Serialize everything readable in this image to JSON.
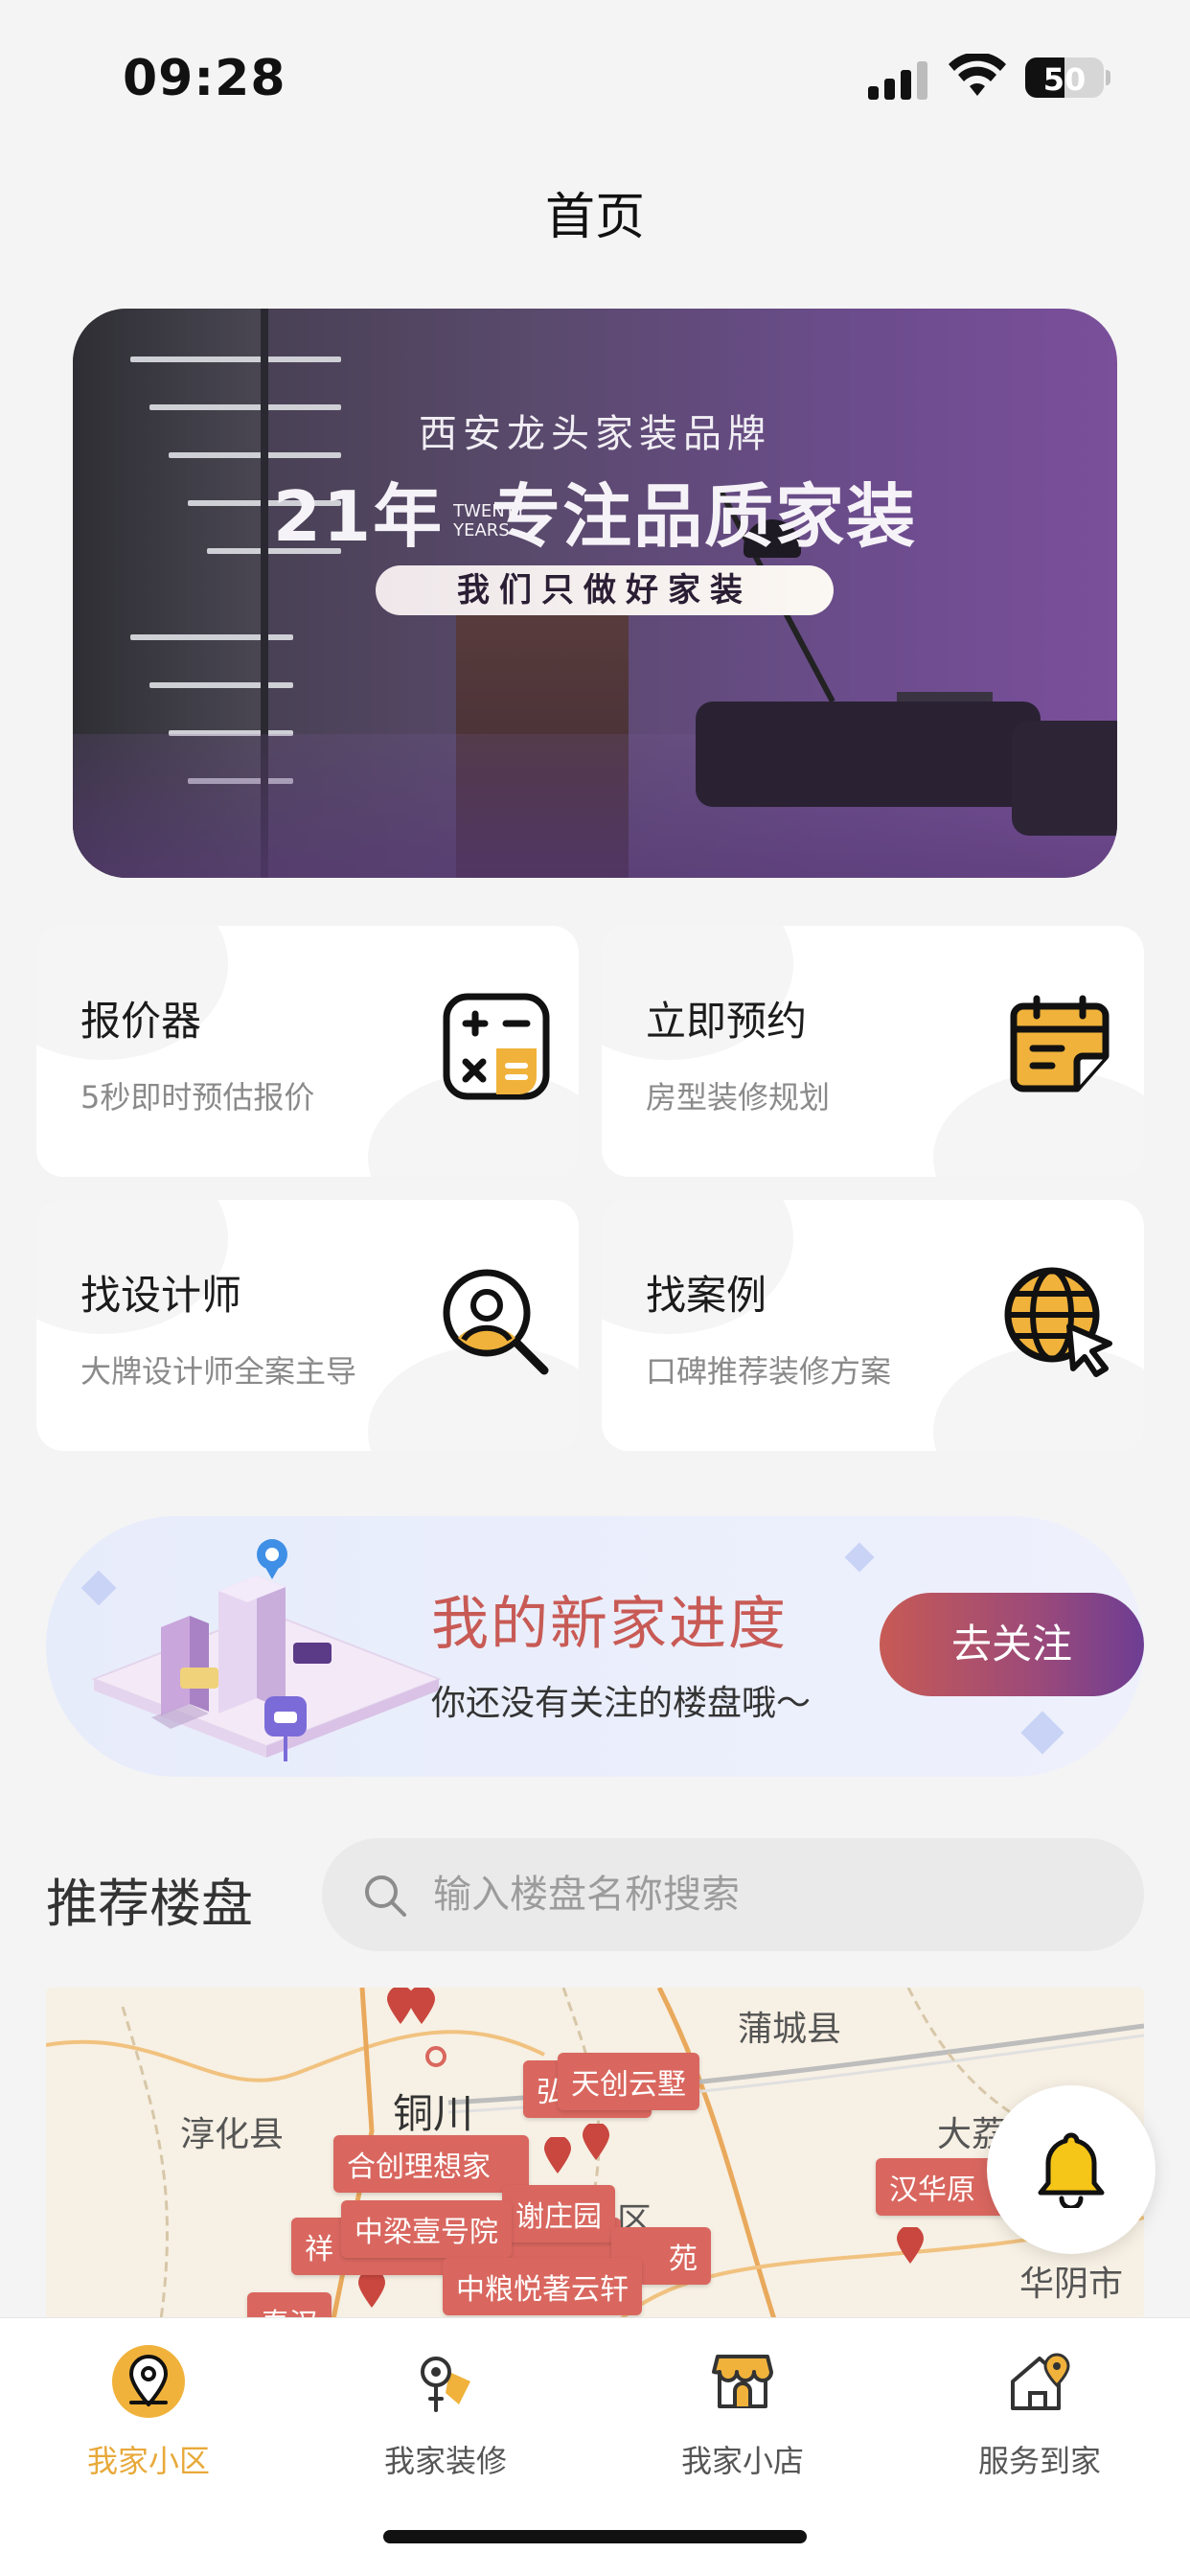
{
  "status_bar": {
    "time": "09:28",
    "battery": "50",
    "battery_level": 0.5
  },
  "header": {
    "title": "首页"
  },
  "banner": {
    "subtitle": "西安龙头家装品牌",
    "headline_years": "21年",
    "headline_tag": "TWENTY YEARS",
    "headline_main": "专注品质家装",
    "pill": "我们只做好家装"
  },
  "grid": {
    "items": [
      {
        "title": "报价器",
        "subtitle": "5秒即时预估报价",
        "icon": "calculator-icon"
      },
      {
        "title": "立即预约",
        "subtitle": "房型装修规划",
        "icon": "calendar-icon"
      },
      {
        "title": "找设计师",
        "subtitle": "大牌设计师全案主导",
        "icon": "designer-search-icon"
      },
      {
        "title": "找案例",
        "subtitle": "口碑推荐装修方案",
        "icon": "globe-cursor-icon"
      }
    ]
  },
  "progress": {
    "title": "我的新家进度",
    "subtitle": "你还没有关注的楼盘哦～",
    "button": "去关注"
  },
  "recommend": {
    "title": "推荐楼盘",
    "search_placeholder": "输入楼盘名称搜索"
  },
  "map": {
    "places": [
      "蒲城县",
      "铜川",
      "淳化县",
      "大荔",
      "华阴市",
      "区"
    ],
    "tags": [
      "天创云墅",
      "弘",
      "合创理想家",
      "中梁壹号院",
      "谢庄园",
      "祥",
      "中粮悦著云轩",
      "苑",
      "汉华原",
      "秦汉"
    ]
  },
  "colors": {
    "accent": "#e8a93a",
    "map_tag": "#d9675f",
    "progress_title": "#c85a55",
    "button_gradient_start": "#c75a55",
    "button_gradient_end": "#6d3d93"
  },
  "tabbar": {
    "tabs": [
      {
        "label": "我家小区",
        "icon": "location-pin-icon",
        "active": true
      },
      {
        "label": "我家装修",
        "icon": "brush-icon",
        "active": false
      },
      {
        "label": "我家小店",
        "icon": "store-icon",
        "active": false
      },
      {
        "label": "服务到家",
        "icon": "home-service-icon",
        "active": false
      }
    ]
  }
}
